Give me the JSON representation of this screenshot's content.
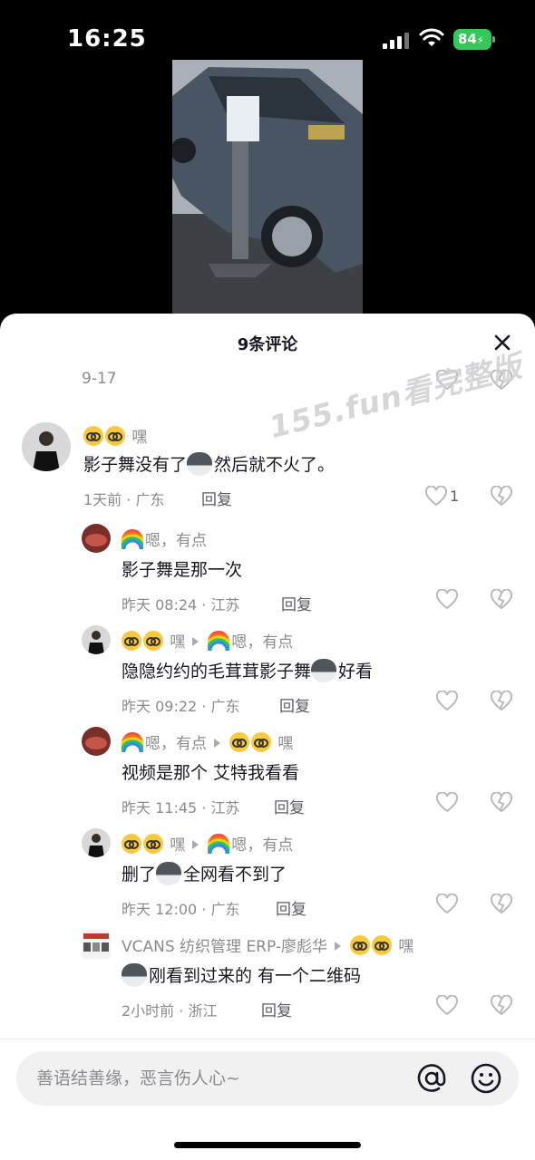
{
  "status_bar": {
    "time": "16:25",
    "battery": "84"
  },
  "sheet": {
    "title": "9条评论",
    "date_label": "9-17"
  },
  "watermark": "155.fun看完整版",
  "comments": [
    {
      "user": "嘿",
      "text_a": "影子舞没有了",
      "text_b": "然后就不火了。",
      "time": "1天前 · 广东",
      "reply": "回复",
      "likes": "1"
    },
    {
      "user": "嗯，有点",
      "text": "影子舞是那一次",
      "time": "昨天 08:24 · 江苏",
      "reply": "回复"
    },
    {
      "user": "嘿",
      "reply_to": "嗯，有点",
      "text_a": "隐隐约约的毛茸茸影子舞",
      "text_b": "好看",
      "time": "昨天 09:22 · 广东",
      "reply": "回复"
    },
    {
      "user": "嗯，有点",
      "reply_to": "嘿",
      "text": "视频是那个 艾特我看看",
      "time": "昨天 11:45 · 江苏",
      "reply": "回复"
    },
    {
      "user": "嘿",
      "reply_to": "嗯，有点",
      "text_a": "删了",
      "text_b": "全网看不到了",
      "time": "昨天 12:00 · 广东",
      "reply": "回复"
    },
    {
      "user": "VCANS 纺织管理 ERP-廖彪华",
      "reply_to": "嘿",
      "text": "刚看到过来的 有一个二维码",
      "time": "2小时前 · 浙江",
      "reply": "回复"
    }
  ],
  "input": {
    "placeholder": "善语结善缘，恶言伤人心~"
  },
  "icons": [
    "close-icon",
    "heart-icon",
    "broken-heart-icon",
    "at-icon",
    "smile-icon",
    "nerd-emoji",
    "rainbow-emoji",
    "husky-emoji"
  ],
  "colors": {
    "battery": "#34c759",
    "text": "#161823",
    "muted": "#8a8b91"
  }
}
